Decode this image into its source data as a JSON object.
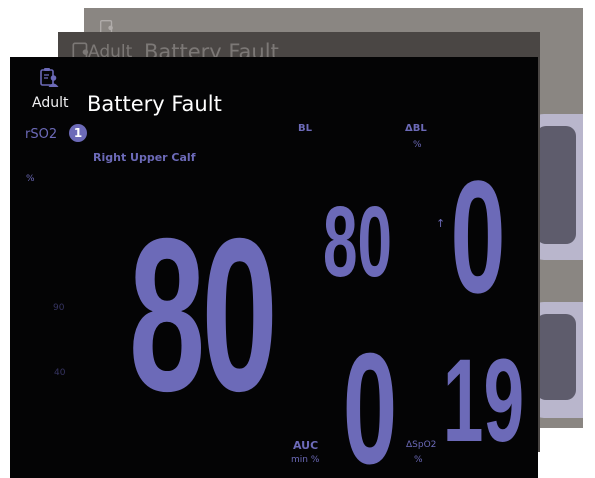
{
  "header": {
    "profile_label": "Adult",
    "alert_title": "Battery Fault"
  },
  "channel": {
    "parameter": "rSO2",
    "number": "1",
    "site": "Right Upper Calf",
    "unit": "%",
    "value": "80",
    "scale_high": "90",
    "scale_low": "40"
  },
  "baseline": {
    "label": "BL",
    "value": "80"
  },
  "delta_baseline": {
    "label": "ΔBL",
    "unit": "%",
    "trend_arrow": "↑",
    "value": "0"
  },
  "auc": {
    "label": "AUC",
    "unit": "min %",
    "value": "0"
  },
  "delta_spo2": {
    "label": "ΔSpO2",
    "unit": "%",
    "value": "19"
  },
  "colors": {
    "accent": "#6c6ab8",
    "screen_background": "#040405",
    "title_text": "#ffffff"
  },
  "icons": {
    "profile": "clipboard-user-icon"
  }
}
